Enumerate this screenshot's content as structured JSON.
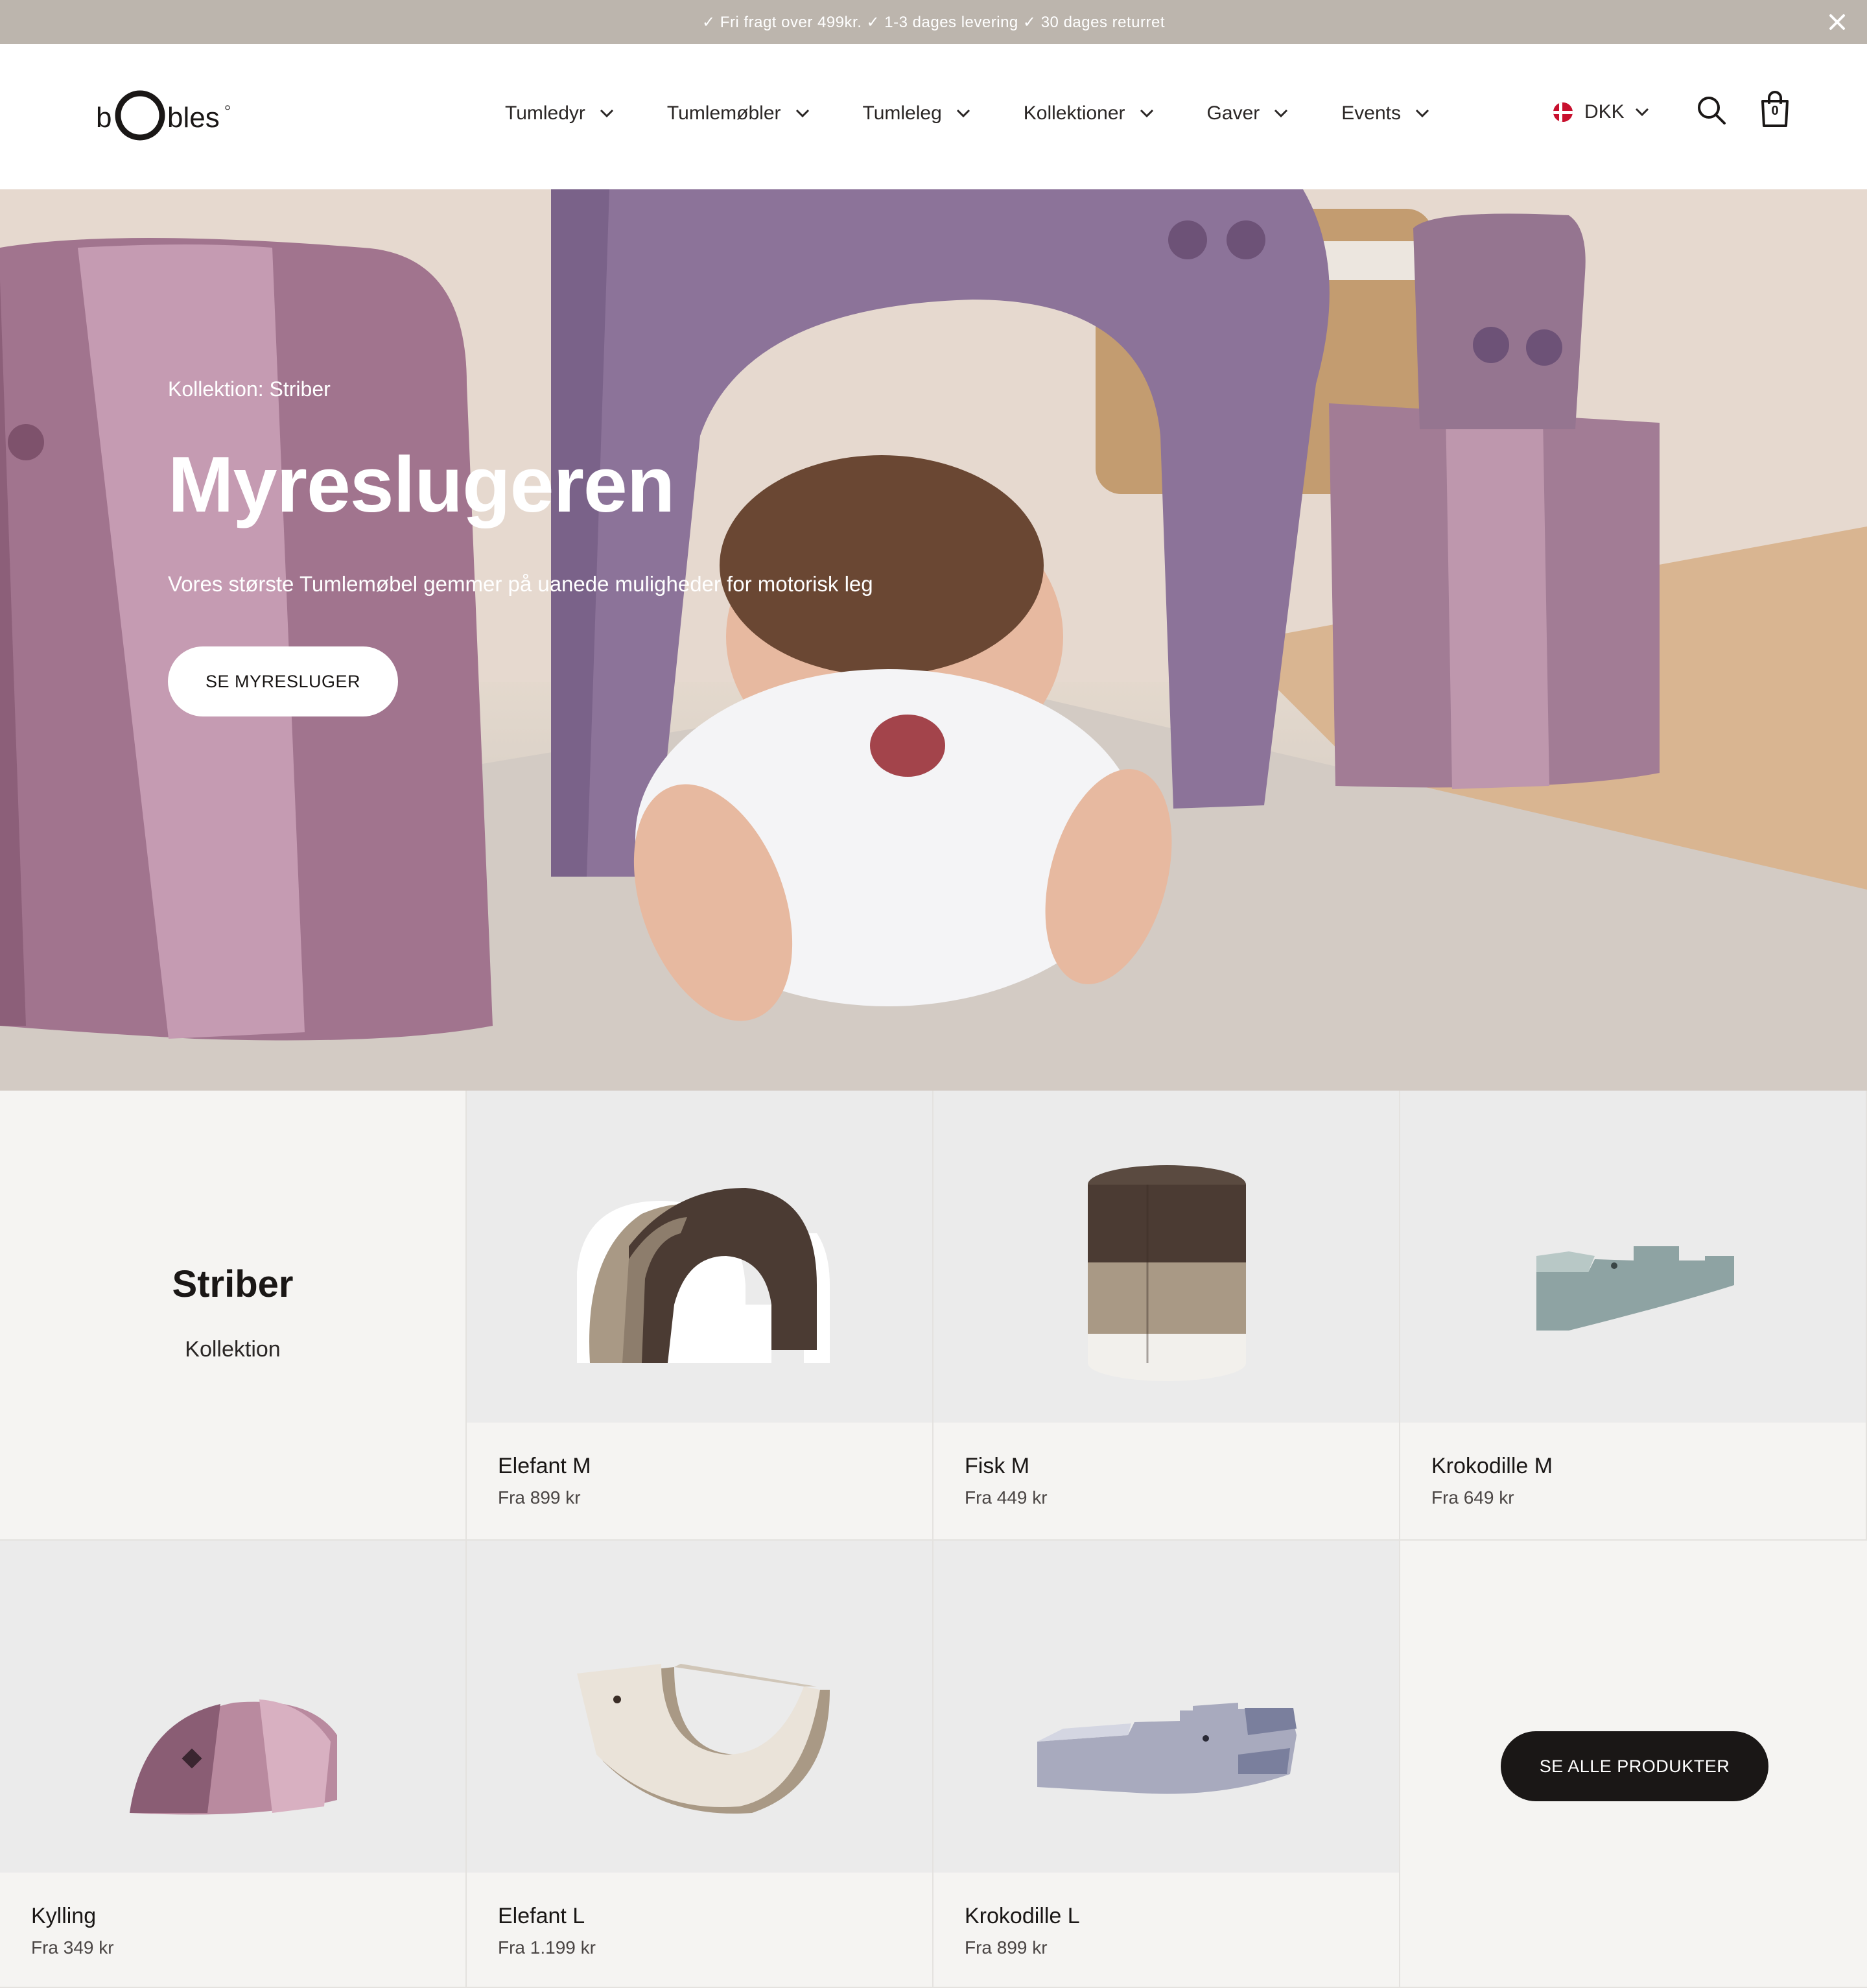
{
  "announcement": {
    "text": "✓ Fri fragt over 499kr. ✓ 1-3 dages levering ✓ 30 dages returret",
    "close_icon": "close-icon"
  },
  "header": {
    "logo_text": "bObles",
    "nav": [
      {
        "label": "Tumledyr"
      },
      {
        "label": "Tumlemøbler"
      },
      {
        "label": "Tumleleg"
      },
      {
        "label": "Kollektioner"
      },
      {
        "label": "Gaver"
      },
      {
        "label": "Events"
      }
    ],
    "currency": "DKK",
    "cart_count": "0"
  },
  "hero": {
    "eyebrow": "Kollektion: Striber",
    "title": "Myreslugeren",
    "subtitle": "Vores største Tumlemøbel gemmer på uanede muligheder for motorisk leg",
    "cta": "SE MYRESLUGER"
  },
  "collection": {
    "title": "Striber",
    "subtitle": "Kollektion"
  },
  "products": [
    {
      "name": "Elefant M",
      "price": "Fra 899 kr"
    },
    {
      "name": "Fisk M",
      "price": "Fra 449 kr"
    },
    {
      "name": "Krokodille M",
      "price": "Fra 649 kr"
    },
    {
      "name": "Kylling",
      "price": "Fra 349 kr"
    },
    {
      "name": "Elefant L",
      "price": "Fra 1.199 kr"
    },
    {
      "name": "Krokodille L",
      "price": "Fra 899 kr"
    }
  ],
  "see_all": "SE ALLE PRODUKTER",
  "colors": {
    "announcement_bg": "#bcb5ad",
    "dark": "#1a1716",
    "card_bg": "#f5f4f2",
    "image_bg": "#ebebeb"
  }
}
